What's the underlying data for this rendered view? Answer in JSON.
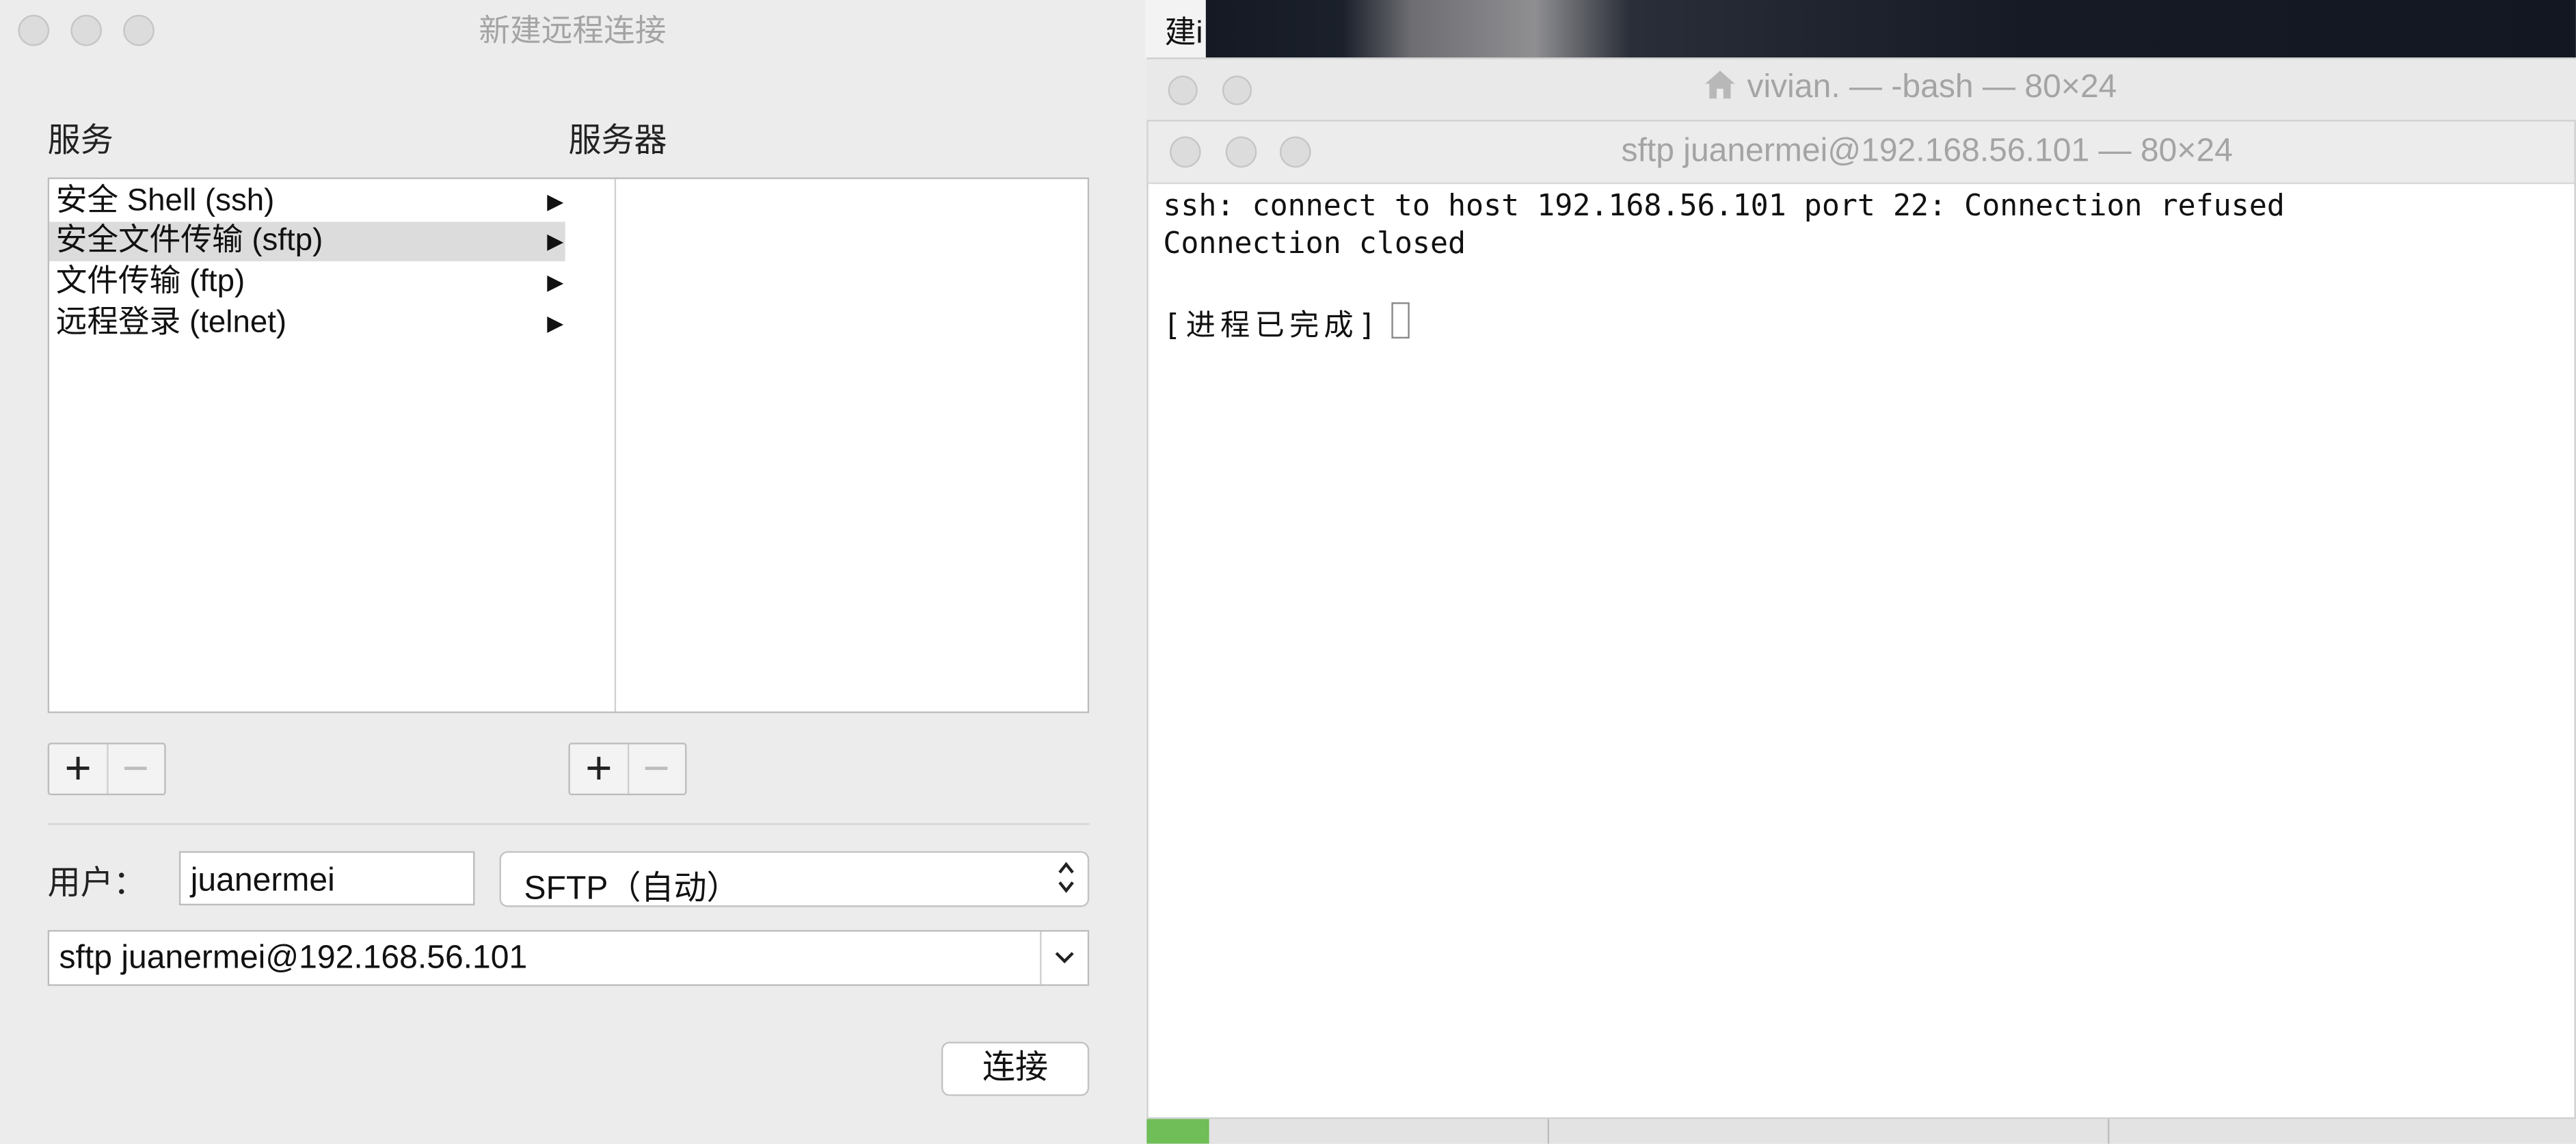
{
  "dialog": {
    "title": "新建远程连接",
    "services_header": "服务",
    "servers_header": "服务器",
    "services": [
      {
        "label": "安全 Shell (ssh)",
        "selected": false
      },
      {
        "label": "安全文件传输 (sftp)",
        "selected": true
      },
      {
        "label": "文件传输 (ftp)",
        "selected": false
      },
      {
        "label": "远程登录 (telnet)",
        "selected": false
      }
    ],
    "servers": [],
    "add_symbol": "+",
    "remove_symbol": "−",
    "user_label": "用户：",
    "user_value": "juanermei",
    "protocol_value": "SFTP（自动）",
    "command_value": "sftp juanermei@192.168.56.101",
    "connect_label": "连接"
  },
  "background": {
    "window_label": "建i",
    "bash_title": "vivian. — -bash — 80×24"
  },
  "terminal": {
    "title": "sftp juanermei@192.168.56.101 — 80×24",
    "lines": [
      "ssh: connect to host 192.168.56.101 port 22: Connection refused",
      "Connection closed",
      "",
      "[进程已完成]"
    ]
  },
  "icons": {
    "disclosure": "triangle-right-icon",
    "home": "home-icon",
    "stepper": "up-down-chevron-icon",
    "dropdown": "chevron-down-icon"
  }
}
